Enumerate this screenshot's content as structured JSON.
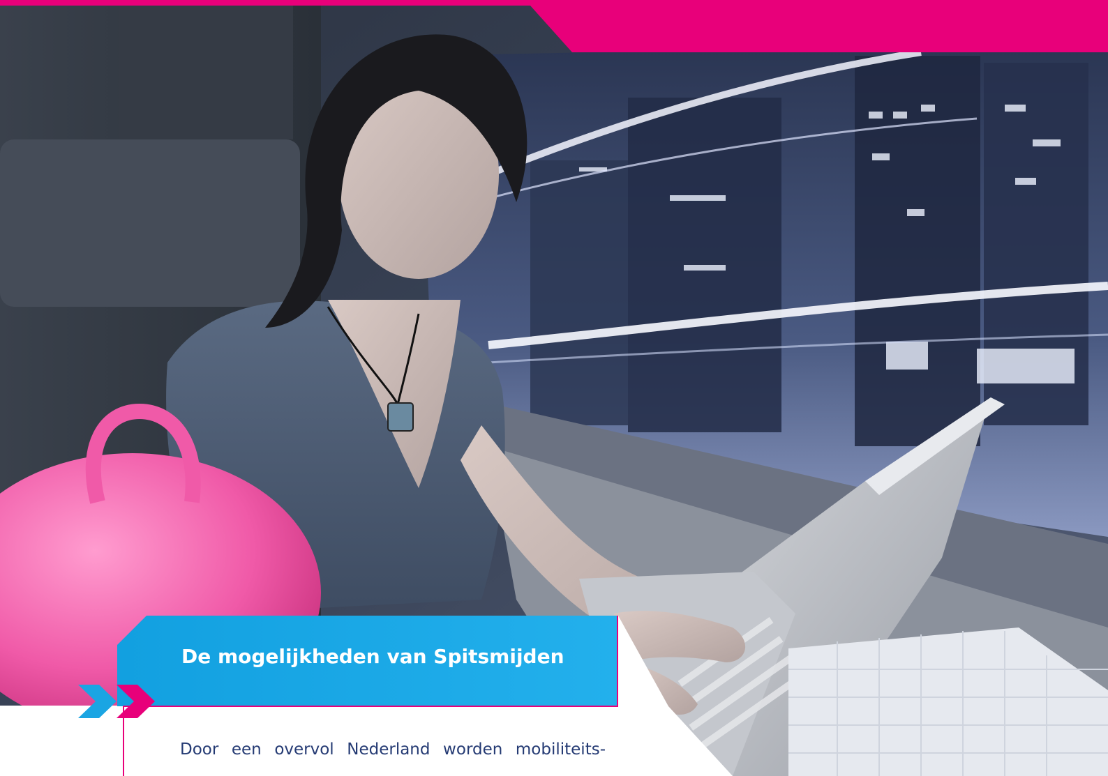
{
  "heading": "De mogelijkheden van Spitsmijden",
  "body_text": "Door een overvol Nederland worden mobiliteits-",
  "colors": {
    "brand_pink": "#e8007a",
    "brand_blue": "#1aa5e3",
    "text_navy": "#243a73"
  },
  "photo": {
    "description_icon": "woman-on-laptop-in-train-photo"
  }
}
